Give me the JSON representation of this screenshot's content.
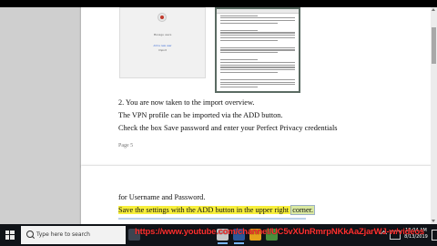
{
  "document": {
    "page1": {
      "embedded_left": {
        "title": "Manage users",
        "link1": "Add a new user",
        "link2": "Import"
      },
      "lines": [
        "2. You are now taken to the import overview.",
        "The VPN profile can be imported via the ADD button.",
        "Check the box Save password and enter your Perfect Privacy credentials"
      ],
      "page_label": "Page 5"
    },
    "page2": {
      "line1": "for Username and Password.",
      "line2_main": "Save the settings with the ADD button in the upper right ",
      "line2_end": "corner."
    }
  },
  "taskbar": {
    "search_placeholder": "Type here to search",
    "overlay_url": "https://www.youtube.com/channel/UC5vXUnRmrpNKkAaZjarWJ-w/videos",
    "clock_time": "12:04 AM",
    "clock_date": "8/13/2019"
  },
  "colors": {
    "highlight": "#f7ef3c",
    "overlay_url": "#ff3030",
    "taskbar": "#101318"
  }
}
